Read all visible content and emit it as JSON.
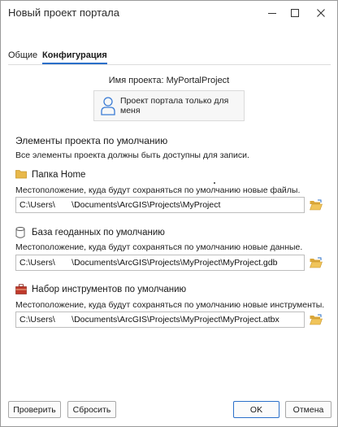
{
  "window": {
    "title": "Новый проект портала",
    "minimize_icon": "minimize-icon",
    "maximize_icon": "maximize-icon",
    "close_icon": "close-icon"
  },
  "tabs": [
    {
      "label": "Общие",
      "active": false
    },
    {
      "label": "Конфигурация",
      "active": true
    }
  ],
  "project_name_label": "Имя проекта: MyPortalProject",
  "sharing": {
    "icon": "user-icon",
    "label": "Проект портала только для меня"
  },
  "defaults": {
    "title": "Элементы проекта по умолчанию",
    "note": "Все элементы проекта должны быть доступны для записи."
  },
  "home_folder": {
    "icon": "folder-icon",
    "title": "Папка Home",
    "description": "Местоположение, куда будут сохраняться по умолчанию новые файлы.",
    "path": "C:\\Users\\       \\Documents\\ArcGIS\\Projects\\MyProject",
    "browse_icon": "open-folder-icon"
  },
  "geodatabase": {
    "icon": "database-icon",
    "title": "База геоданных по умолчанию",
    "description": "Местоположение, куда будут сохраняться по умолчанию новые данные.",
    "path": "C:\\Users\\       \\Documents\\ArcGIS\\Projects\\MyProject\\MyProject.gdb",
    "browse_icon": "open-folder-icon"
  },
  "toolbox": {
    "icon": "toolbox-icon",
    "title": "Набор инструментов по умолчанию",
    "description": "Местоположение, куда будут сохраняться по умолчанию новые инструменты.",
    "path": "C:\\Users\\       \\Documents\\ArcGIS\\Projects\\MyProject\\MyProject.atbx",
    "browse_icon": "open-folder-icon"
  },
  "buttons": {
    "validate": "Проверить",
    "reset": "Сбросить",
    "ok": "OK",
    "cancel": "Отмена"
  },
  "colors": {
    "accent": "#2a6fc9",
    "folder": "#e8b84a",
    "toolbox": "#c0392b"
  }
}
